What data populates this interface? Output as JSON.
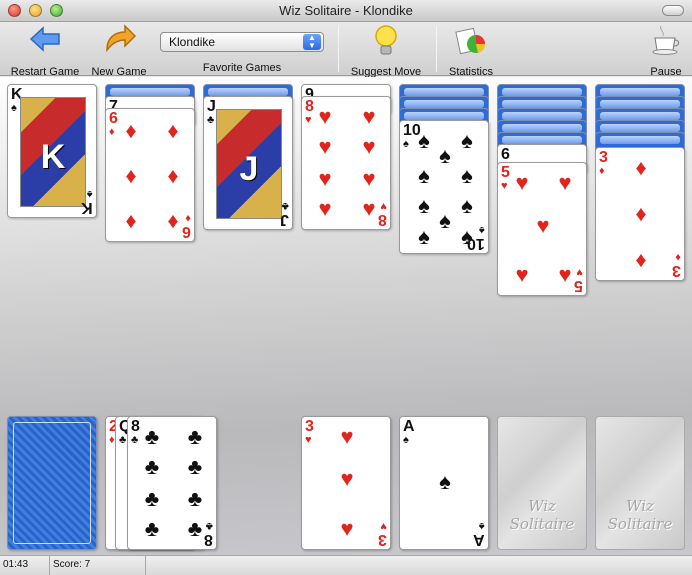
{
  "window": {
    "title": "Wiz Solitaire - Klondike"
  },
  "toolbar": {
    "restart_label": "Restart Game",
    "new_label": "New Game",
    "favorite_label": "Favorite Games",
    "favorite_value": "Klondike",
    "suggest_label": "Suggest Move",
    "stats_label": "Statistics",
    "pause_label": "Pause"
  },
  "cards": {
    "t1_top": {
      "rank": "K",
      "suit": "♠"
    },
    "t2_under": {
      "rank": "7"
    },
    "t2_top": {
      "rank": "6",
      "suit": "♦"
    },
    "t3_top": {
      "rank": "J",
      "suit": "♣"
    },
    "t4_under": {
      "rank": "9"
    },
    "t4_top": {
      "rank": "8",
      "suit": "♥"
    },
    "t5_top": {
      "rank": "10",
      "suit": "♠"
    },
    "t6_under": {
      "rank": "6"
    },
    "t6_top": {
      "rank": "5",
      "suit": "♥"
    },
    "t7_top": {
      "rank": "3",
      "suit": "♦"
    },
    "w1": {
      "rank": "2",
      "suit": "♦"
    },
    "w2": {
      "rank": "Q",
      "suit": "♣"
    },
    "w3": {
      "rank": "8",
      "suit": "♣"
    },
    "f1": {
      "rank": "3",
      "suit": "♥"
    },
    "f2": {
      "rank": "A",
      "suit": "♠"
    }
  },
  "foundation_watermark": {
    "line1": "Wiz",
    "line2": "Solitaire"
  },
  "status": {
    "time": "01:43",
    "score": "Score: 7"
  },
  "colors": {
    "red_suit": "#e0261c",
    "black_suit": "#111111",
    "card_back": "#2e6bd4"
  },
  "icons": [
    "restart-arrow-icon",
    "new-game-arrow-icon",
    "lightbulb-icon",
    "statistics-icon",
    "coffee-cup-icon"
  ]
}
